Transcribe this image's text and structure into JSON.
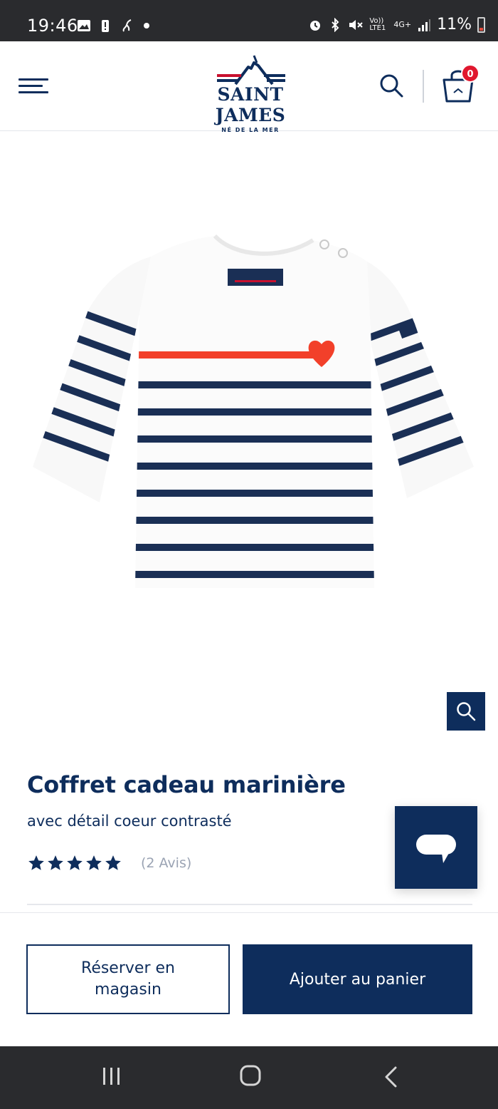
{
  "status_bar": {
    "time": "19:46",
    "battery": "11%",
    "network": "4G+",
    "volte": "Vo)) LTE1"
  },
  "header": {
    "brand": "SAINT JAMES",
    "tagline": "NÉ DE LA MER",
    "cart_count": "0"
  },
  "product": {
    "title": "Coffret cadeau marinière",
    "subtitle": "avec détail coeur contrasté",
    "rating": 5,
    "rating_max": 5,
    "reviews_label": "(2 Avis)",
    "image_alt": "Marinière bébé rayée blanche et marine avec cœur rouge"
  },
  "actions": {
    "reserve_label": "Réserver en magasin",
    "add_to_cart_label": "Ajouter au panier"
  },
  "colors": {
    "navy": "#0e2d5c",
    "red": "#e0172e",
    "stripe": "#1a2f55",
    "heart": "#f2402a",
    "system_bar": "#2a2b2e"
  }
}
